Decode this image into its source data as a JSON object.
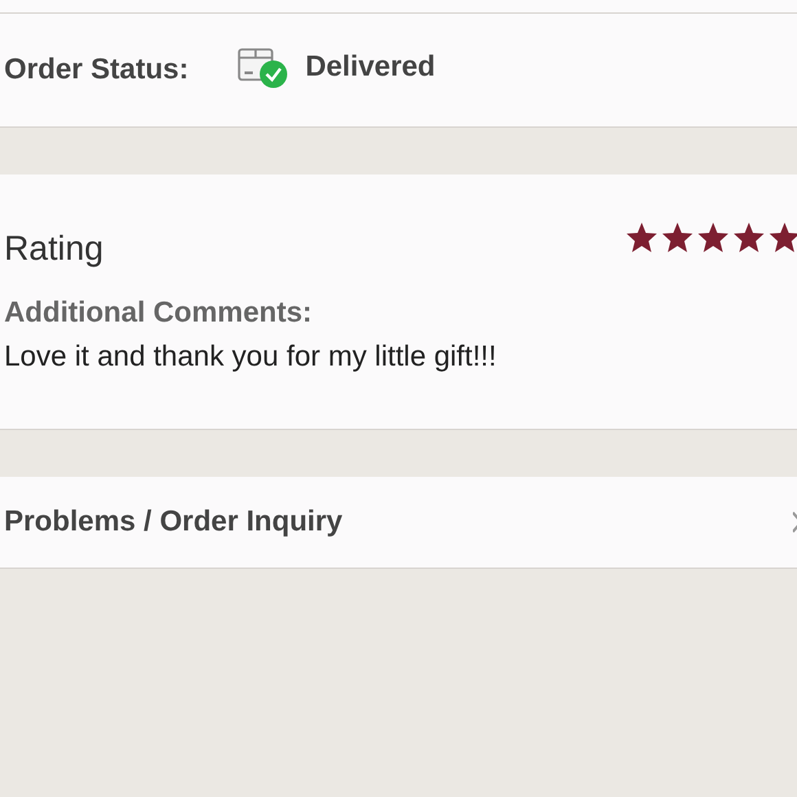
{
  "order_status": {
    "label": "Order Status:",
    "value": "Delivered"
  },
  "rating": {
    "title": "Rating",
    "stars": 5,
    "comments_label": "Additional Comments:",
    "comments": "Love it and thank you for my little gift!!!"
  },
  "problems": {
    "label": "Problems / Order Inquiry"
  }
}
